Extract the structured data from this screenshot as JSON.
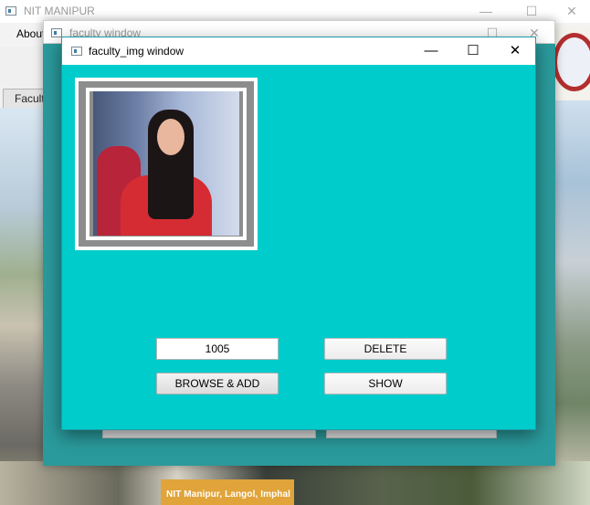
{
  "main_window": {
    "title": "NIT MANIPUR",
    "menu": [
      "About"
    ],
    "side_button": "Faculty",
    "caption": "NIT Manipur, Langol, Imphal"
  },
  "faculty_window": {
    "title": "faculty window"
  },
  "img_window": {
    "title": "faculty_img window",
    "id_value": "1005",
    "delete_label": "DELETE",
    "browse_label": "BROWSE & ADD",
    "show_label": "SHOW"
  },
  "window_controls": {
    "minimize": "—",
    "maximize": "☐",
    "close": "✕"
  },
  "colors": {
    "img_window_bg": "#00cccc",
    "faculty_window_bg": "#2a9a9c"
  }
}
